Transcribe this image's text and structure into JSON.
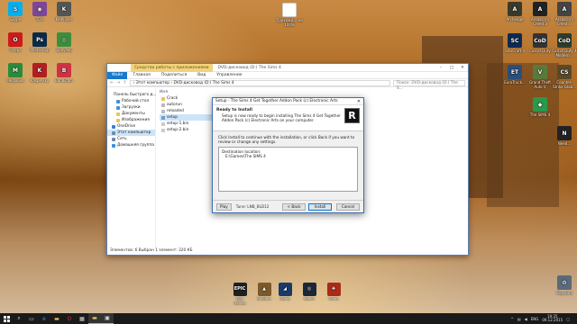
{
  "desktop": {
    "left_icons": [
      {
        "label": "Skype",
        "name": "skype-icon",
        "color": "#00aff0",
        "glyph": "S"
      },
      {
        "label": "TOR",
        "name": "tor-icon",
        "color": "#7d4698",
        "glyph": "◉"
      },
      {
        "label": "KMPlayer",
        "name": "kmplayer-icon",
        "color": "#555555",
        "glyph": "K"
      },
      {
        "label": "Опера",
        "name": "opera-icon",
        "color": "#cc1b1b",
        "glyph": "O"
      },
      {
        "label": "Photoshop",
        "name": "photoshop-icon",
        "color": "#0b2a4a",
        "glyph": "Ps"
      },
      {
        "label": "Браузер",
        "name": "chrome-icon",
        "color": "#3b8e3b",
        "glyph": "◎"
      },
      {
        "label": "MediaGet",
        "name": "mediaget-icon",
        "color": "#2a8c3a",
        "glyph": "M"
      },
      {
        "label": "Kaspersky",
        "name": "kaspersky-icon",
        "color": "#b02020",
        "glyph": "K"
      },
      {
        "label": "Bandicam",
        "name": "bandicam-icon",
        "color": "#cc3344",
        "glyph": "B"
      }
    ],
    "center_icon": {
      "label": "Прохожд... на 100%",
      "name": "text-file-icon"
    },
    "right_icons": [
      {
        "label": "Archeage",
        "name": "archeage-icon",
        "glyph": "A",
        "color": "#3a3a2a"
      },
      {
        "label": "Assassin's Creed 3",
        "name": "assassins-creed-3-icon",
        "glyph": "A",
        "color": "#222222"
      },
      {
        "label": "Assassin's Creed ...",
        "name": "assassins-creed-icon",
        "glyph": "A",
        "color": "#444444"
      },
      {
        "label": "StarCraft II",
        "name": "starcraft-icon",
        "glyph": "SC",
        "color": "#0d2a55"
      },
      {
        "label": "Call of Duty",
        "name": "call-of-duty-icon",
        "glyph": "CoD",
        "color": "#333333"
      },
      {
        "label": "Call of Duty 4 Modern...",
        "name": "cod4-icon",
        "glyph": "CoD",
        "color": "#2d3d2d"
      },
      {
        "label": "EuroTruck...",
        "name": "eurotruck-icon",
        "glyph": "ET",
        "color": "#2b4e7a"
      },
      {
        "label": "Grand Theft Auto V",
        "name": "gta5-icon",
        "glyph": "V",
        "color": "#5a7a3a"
      },
      {
        "label": "Counter-Strike Glob...",
        "name": "csgo-icon",
        "glyph": "CS",
        "color": "#5a4a2a"
      },
      {
        "label": "The SIMS 4",
        "name": "sims4-icon",
        "glyph": "◆",
        "color": "#2a9a4a"
      },
      {
        "label": "Need...",
        "name": "need-for-speed-icon",
        "glyph": "N",
        "color": "#222222"
      },
      {
        "label": "Корзина",
        "name": "recycle-bin-icon",
        "glyph": "♻",
        "color": "#5a6a7a"
      }
    ],
    "dock_icons": [
      {
        "label": "Epic Games",
        "name": "epic-games-icon",
        "glyph": "EPIC",
        "color": "#202020"
      },
      {
        "label": "Builders",
        "name": "builders-icon",
        "glyph": "▲",
        "color": "#7a5a2a"
      },
      {
        "label": "Game",
        "name": "game-icon",
        "glyph": "◢",
        "color": "#1a3a6a"
      },
      {
        "label": "Steam",
        "name": "steam-icon",
        "glyph": "◎",
        "color": "#1b2838"
      },
      {
        "label": "Game",
        "name": "game2-icon",
        "glyph": "✚",
        "color": "#aa2a1a"
      }
    ]
  },
  "explorer": {
    "tools_tab": "Средства работы с приложениями",
    "title": "DVD-дисковод (D:) The Sims 4",
    "ribbon_tabs": [
      "Файл",
      "Главная",
      "Поделиться",
      "Вид",
      "Управление"
    ],
    "address": "›  Этот компьютер  ›  DVD-дисковод (D:) The Sims 4",
    "search_placeholder": "Поиск: DVD-дисковод (D:) The S...",
    "column_header": "Имя",
    "nav_items": [
      {
        "label": "Панель быстрого д...",
        "color": "#3d8ee0",
        "indent": false,
        "selected": false
      },
      {
        "label": "Рабочий стол",
        "color": "#3d8ee0",
        "indent": true,
        "selected": false
      },
      {
        "label": "Загрузки",
        "color": "#3d8ee0",
        "indent": true,
        "selected": false
      },
      {
        "label": "Документы",
        "color": "#e8c45a",
        "indent": true,
        "selected": false
      },
      {
        "label": "Изображения",
        "color": "#e8c45a",
        "indent": true,
        "selected": false
      },
      {
        "label": "OneDrive",
        "color": "#3a7dd8",
        "indent": false,
        "selected": false
      },
      {
        "label": "Этот компьютер",
        "color": "#6a8ab0",
        "indent": false,
        "selected": true
      },
      {
        "label": "Сеть",
        "color": "#6a8ab0",
        "indent": false,
        "selected": false
      },
      {
        "label": "Домашняя группа",
        "color": "#3d8ee0",
        "indent": false,
        "selected": false
      }
    ],
    "files": [
      {
        "name": "Crack",
        "color": "#e8c45a",
        "selected": false
      },
      {
        "name": "autorun",
        "color": "#bbbbbb",
        "selected": false
      },
      {
        "name": "reloaded",
        "color": "#bbbbbb",
        "selected": false
      },
      {
        "name": "setup",
        "color": "#6aa0d0",
        "selected": true
      },
      {
        "name": "setup-1.bin",
        "color": "#cccccc",
        "selected": false
      },
      {
        "name": "setup-2.bin",
        "color": "#cccccc",
        "selected": false
      }
    ],
    "status": "Элементов: 6    Выбран 1 элемент: 320 КБ"
  },
  "setup": {
    "title": "Setup - The Sims 4 Get Together Addon Pack (c) Electronic Arts",
    "heading": "Ready to Install",
    "subheading": "Setup is now ready to begin installing The Sims 4 Get Together Addon Pack (c) Electronic Arts on your computer.",
    "logo_glyph": "R",
    "instruction": "Click Install to continue with the installation, or click Back if you want to review or change any settings.",
    "dest_label": "Destination location:",
    "dest_value": "E:\\Games\\The SIMS 4",
    "play_label": "Play",
    "tune_label": "Tune: LNB_BLD12",
    "back_label": "< Back",
    "install_label": "Install",
    "cancel_label": "Cancel"
  },
  "taskbar": {
    "tray_lang": "ENG",
    "time": "19:25",
    "date": "09.12.2015"
  }
}
